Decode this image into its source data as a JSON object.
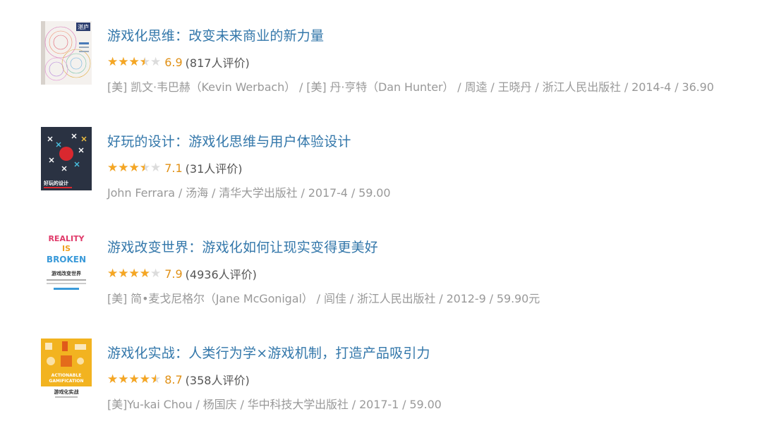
{
  "books": [
    {
      "title": "游戏化思维：改变未来商业的新力量",
      "rating_value": 6.9,
      "score": "6.9",
      "count": "(817人评价)",
      "info": "[美] 凯文·韦巴赫（Kevin Werbach） / [美] 丹·亨特（Dan Hunter） / 周逵 / 王晓丹 / 浙江人民出版社 / 2014-4 / 36.90",
      "cover_text": "湛庐"
    },
    {
      "title": "好玩的设计：游戏化思维与用户体验设计",
      "rating_value": 7.1,
      "score": "7.1",
      "count": "(31人评价)",
      "info": "John Ferrara / 汤海 / 清华大学出版社 / 2017-4 / 59.00",
      "cover_text": "好玩的设计"
    },
    {
      "title": "游戏改变世界：游戏化如何让现实变得更美好",
      "rating_value": 7.9,
      "score": "7.9",
      "count": "(4936人评价)",
      "info": "[美] 简•麦戈尼格尔（Jane McGonigal） / 闾佳 / 浙江人民出版社 / 2012-9 / 59.90元",
      "cover_lines": [
        "REALITY",
        "IS",
        "BROKEN"
      ],
      "cover_text": "游戏改变世界"
    },
    {
      "title": "游戏化实战：人类行为学×游戏机制，打造产品吸引力",
      "rating_value": 8.7,
      "score": "8.7",
      "count": "(358人评价)",
      "info": "[美]Yu-kai Chou / 杨国庆 / 华中科技大学出版社 / 2017-1 / 59.00",
      "cover_lines": [
        "ACTIONABLE",
        "GAMIFICATION"
      ],
      "cover_text": "游戏化实战"
    }
  ],
  "colors": {
    "title": "#3377aa",
    "star": "#f5a623",
    "score": "#e09015",
    "meta": "#999999"
  }
}
